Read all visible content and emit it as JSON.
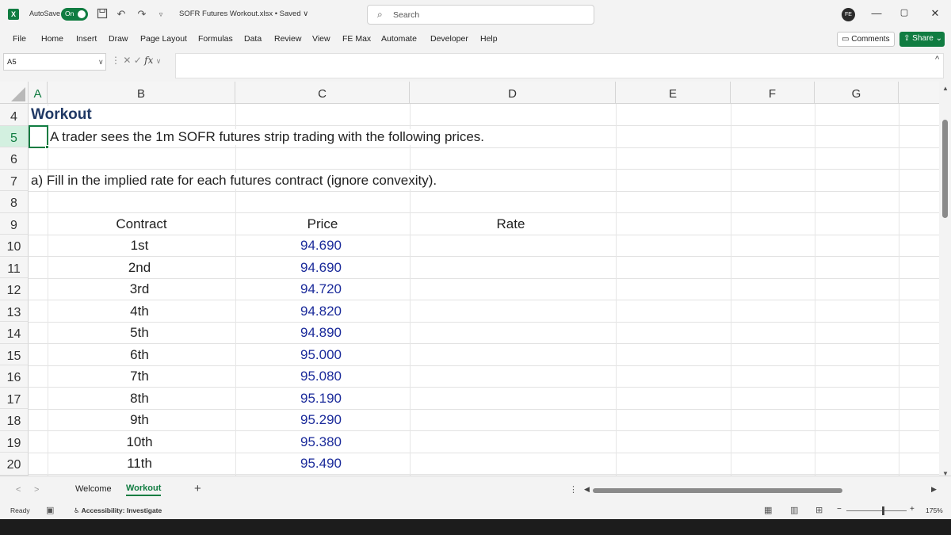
{
  "titlebar": {
    "app_badge": "X",
    "autosave_label": "AutoSave",
    "autosave_state": "On",
    "doc_title": "SOFR Futures Workout.xlsx • Saved ∨",
    "search_placeholder": "Search",
    "minimize": "—",
    "restore": "▢",
    "close": "✕"
  },
  "ribbon": {
    "tabs": [
      "File",
      "Home",
      "Insert",
      "Draw",
      "Page Layout",
      "Formulas",
      "Data",
      "Review",
      "View",
      "FE Max",
      "Automate",
      "Developer",
      "Help"
    ],
    "comments_label": "Comments",
    "share_label": "Share"
  },
  "formula_bar": {
    "name_box": "A5",
    "fx_label": "fx",
    "value": ""
  },
  "columns": [
    "A",
    "B",
    "C",
    "D",
    "E",
    "F",
    "G"
  ],
  "rows": [
    "4",
    "5",
    "6",
    "7",
    "8",
    "9",
    "10",
    "11",
    "12",
    "13",
    "14",
    "15",
    "16",
    "17",
    "18",
    "19",
    "20"
  ],
  "sheet": {
    "title": "Workout",
    "intro": "A trader sees the 1m SOFR futures strip trading with the following prices.",
    "question": "a)  Fill in the implied rate for each futures contract (ignore convexity).",
    "headers": {
      "contract": "Contract",
      "price": "Price",
      "rate": "Rate"
    },
    "contracts": [
      "1st",
      "2nd",
      "3rd",
      "4th",
      "5th",
      "6th",
      "7th",
      "8th",
      "9th",
      "10th",
      "11th"
    ],
    "prices": [
      "94.690",
      "94.690",
      "94.720",
      "94.820",
      "94.890",
      "95.000",
      "95.080",
      "95.190",
      "95.290",
      "95.380",
      "95.490"
    ]
  },
  "sheet_tabs": [
    "Welcome",
    "Workout"
  ],
  "status": {
    "ready": "Ready",
    "accessibility": "Accessibility: Investigate",
    "zoom": "175%"
  },
  "colors": {
    "excel_green": "#107c41",
    "price_blue": "#1a2a9a",
    "title_navy": "#1f3864"
  }
}
